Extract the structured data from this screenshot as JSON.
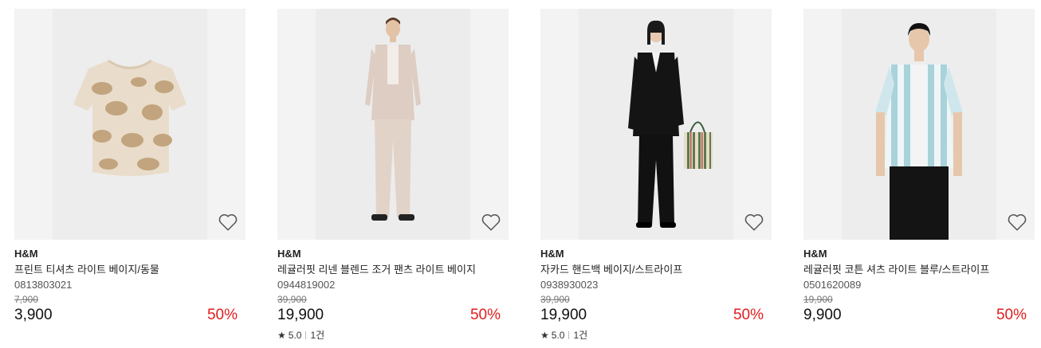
{
  "products": [
    {
      "brand": "H&M",
      "name": "프린트 티셔츠 라이트 베이지/동물",
      "code": "0813803021",
      "original_price": "7,900",
      "price": "3,900",
      "discount": "50%",
      "rating": "",
      "reviews": "",
      "image": "beige-animal-print-tshirt"
    },
    {
      "brand": "H&M",
      "name": "레귤러핏 리넨 블렌드 조거 팬츠 라이트 베이지",
      "code": "0944819002",
      "original_price": "39,900",
      "price": "19,900",
      "discount": "50%",
      "rating": "5.0",
      "reviews": "1건",
      "image": "model-beige-linen-set"
    },
    {
      "brand": "H&M",
      "name": "자카드 핸드백 베이지/스트라이프",
      "code": "0938930023",
      "original_price": "39,900",
      "price": "19,900",
      "discount": "50%",
      "rating": "5.0",
      "reviews": "1건",
      "image": "model-black-suit-striped-bag"
    },
    {
      "brand": "H&M",
      "name": "레귤러핏 코튼 셔츠 라이트 블루/스트라이프",
      "code": "0501620089",
      "original_price": "19,900",
      "price": "9,900",
      "discount": "50%",
      "rating": "",
      "reviews": "",
      "image": "model-blue-striped-shirt"
    }
  ],
  "colors": {
    "discount": "#e21d1d",
    "image_bg": "#f3f3f3"
  },
  "icons": {
    "wishlist": "heart-outline-icon",
    "rating": "star-icon"
  }
}
